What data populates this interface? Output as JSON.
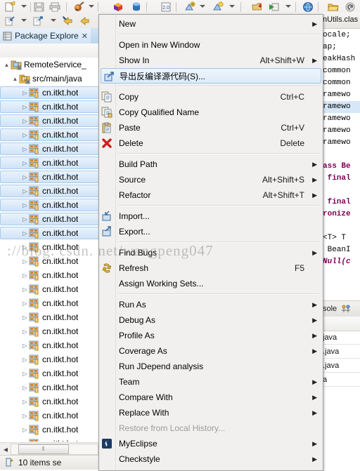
{
  "toolbar": {
    "row1_icons": [
      "new-wizard-icon",
      "dropdown-arrow",
      "save-icon",
      "print-icon",
      "separator",
      "debug-icon",
      "dropdown-arrow",
      "separator",
      "myeclipse-cube-icon",
      "myeclipse-db-icon",
      "separator",
      "java2-icon",
      "separator",
      "new-java-project-icon",
      "dropdown-arrow",
      "new-class-icon",
      "dropdown-arrow",
      "separator",
      "deploy-icon",
      "run-icon",
      "dropdown-arrow",
      "separator",
      "open-browser-icon",
      "separator",
      "open-folder-icon",
      "revert-icon"
    ],
    "row2_icons": [
      "import-icon",
      "dropdown-arrow",
      "export-icon",
      "dropdown-arrow",
      "back-history-icon",
      "forward-history-icon"
    ]
  },
  "package_explorer": {
    "tab_title": "Package Explore",
    "close_glyph": "✕",
    "view_icon": "package-explorer-icon",
    "tree": [
      {
        "level": 0,
        "twisty": "▲",
        "icon": "java-project-icon",
        "label": "RemoteService_",
        "selected": false
      },
      {
        "level": 1,
        "twisty": "▲",
        "icon": "source-folder-icon",
        "label": "src/main/java",
        "selected": false
      },
      {
        "level": 2,
        "twisty": "▷",
        "icon": "package-icon",
        "label": "cn.itkt.hot",
        "selected": true
      },
      {
        "level": 2,
        "twisty": "▷",
        "icon": "package-icon",
        "label": "cn.itkt.hot",
        "selected": true
      },
      {
        "level": 2,
        "twisty": "▷",
        "icon": "package-icon",
        "label": "cn.itkt.hot",
        "selected": true
      },
      {
        "level": 2,
        "twisty": "▷",
        "icon": "package-icon",
        "label": "cn.itkt.hot",
        "selected": true
      },
      {
        "level": 2,
        "twisty": "▷",
        "icon": "package-icon",
        "label": "cn.itkt.hot",
        "selected": true
      },
      {
        "level": 2,
        "twisty": "▷",
        "icon": "package-icon",
        "label": "cn.itkt.hot",
        "selected": true
      },
      {
        "level": 2,
        "twisty": "▷",
        "icon": "package-icon",
        "label": "cn.itkt.hot",
        "selected": true
      },
      {
        "level": 2,
        "twisty": "▷",
        "icon": "package-icon",
        "label": "cn.itkt.hot",
        "selected": true
      },
      {
        "level": 2,
        "twisty": "▷",
        "icon": "package-icon",
        "label": "cn.itkt.hot",
        "selected": true
      },
      {
        "level": 2,
        "twisty": "▷",
        "icon": "package-icon",
        "label": "cn.itkt.hot",
        "selected": true
      },
      {
        "level": 2,
        "twisty": "▷",
        "icon": "package-icon",
        "label": "cn.itkt.hot",
        "selected": true
      },
      {
        "level": 2,
        "twisty": "▷",
        "icon": "package-icon",
        "label": "cn.itkt.hot",
        "selected": false
      },
      {
        "level": 2,
        "twisty": "▷",
        "icon": "package-icon",
        "label": "cn.itkt.hot",
        "selected": false
      },
      {
        "level": 2,
        "twisty": "▷",
        "icon": "package-icon",
        "label": "cn.itkt.hot",
        "selected": false
      },
      {
        "level": 2,
        "twisty": "▷",
        "icon": "package-icon",
        "label": "cn.itkt.hot",
        "selected": false
      },
      {
        "level": 2,
        "twisty": "▷",
        "icon": "package-icon",
        "label": "cn.itkt.hot",
        "selected": false
      },
      {
        "level": 2,
        "twisty": "▷",
        "icon": "package-icon",
        "label": "cn.itkt.hot",
        "selected": false
      },
      {
        "level": 2,
        "twisty": "▷",
        "icon": "package-icon",
        "label": "cn.itkt.hot",
        "selected": false
      },
      {
        "level": 2,
        "twisty": "▷",
        "icon": "package-icon",
        "label": "cn.itkt.hot",
        "selected": false
      },
      {
        "level": 2,
        "twisty": "▷",
        "icon": "package-icon",
        "label": "cn.itkt.hot",
        "selected": false
      },
      {
        "level": 2,
        "twisty": "▷",
        "icon": "package-icon",
        "label": "cn.itkt.hot",
        "selected": false
      },
      {
        "level": 2,
        "twisty": "▷",
        "icon": "package-icon",
        "label": "cn.itkt.hot",
        "selected": false
      },
      {
        "level": 2,
        "twisty": "▷",
        "icon": "package-icon",
        "label": "cn.itkt.hot",
        "selected": false
      },
      {
        "level": 2,
        "twisty": "▷",
        "icon": "package-icon",
        "label": "cn.itkt.hot",
        "selected": false
      },
      {
        "level": 2,
        "twisty": "▷",
        "icon": "package-icon",
        "label": "cn.itkt.hot",
        "selected": false
      },
      {
        "level": 2,
        "twisty": "▷",
        "icon": "package-icon",
        "label": "cn.itkt.hot",
        "selected": false
      },
      {
        "level": 2,
        "twisty": "▷",
        "icon": "package-icon",
        "label": "cn.itkt.hot",
        "selected": false
      }
    ],
    "hscroll": {
      "left_glyph": "◀",
      "thumb_glyph": "⦀"
    }
  },
  "status_bar": {
    "icon": "selection-icon",
    "text": "10 items se"
  },
  "context_menu": {
    "items": [
      {
        "type": "item",
        "label": "New",
        "accel": "",
        "submenu": true,
        "icon": "",
        "enabled": true,
        "highlighted": false
      },
      {
        "type": "separator"
      },
      {
        "type": "item",
        "label": "Open in New Window",
        "accel": "",
        "submenu": false,
        "icon": "",
        "enabled": true,
        "highlighted": false
      },
      {
        "type": "item",
        "label": "Show In",
        "accel": "Alt+Shift+W",
        "submenu": true,
        "icon": "",
        "enabled": true,
        "highlighted": false
      },
      {
        "type": "item",
        "label": "导出反编译源代码(S)...",
        "accel": "",
        "submenu": false,
        "icon": "export-decompiled-icon",
        "enabled": true,
        "highlighted": true
      },
      {
        "type": "separator"
      },
      {
        "type": "item",
        "label": "Copy",
        "accel": "Ctrl+C",
        "submenu": false,
        "icon": "copy-icon",
        "enabled": true,
        "highlighted": false
      },
      {
        "type": "item",
        "label": "Copy Qualified Name",
        "accel": "",
        "submenu": false,
        "icon": "copy-qualified-icon",
        "enabled": true,
        "highlighted": false
      },
      {
        "type": "item",
        "label": "Paste",
        "accel": "Ctrl+V",
        "submenu": false,
        "icon": "paste-icon",
        "enabled": true,
        "highlighted": false
      },
      {
        "type": "item",
        "label": "Delete",
        "accel": "Delete",
        "submenu": false,
        "icon": "delete-icon",
        "enabled": true,
        "highlighted": false
      },
      {
        "type": "separator"
      },
      {
        "type": "item",
        "label": "Build Path",
        "accel": "",
        "submenu": true,
        "icon": "",
        "enabled": true,
        "highlighted": false
      },
      {
        "type": "item",
        "label": "Source",
        "accel": "Alt+Shift+S",
        "submenu": true,
        "icon": "",
        "enabled": true,
        "highlighted": false
      },
      {
        "type": "item",
        "label": "Refactor",
        "accel": "Alt+Shift+T",
        "submenu": true,
        "icon": "",
        "enabled": true,
        "highlighted": false
      },
      {
        "type": "separator"
      },
      {
        "type": "item",
        "label": "Import...",
        "accel": "",
        "submenu": false,
        "icon": "import-icon",
        "enabled": true,
        "highlighted": false
      },
      {
        "type": "item",
        "label": "Export...",
        "accel": "",
        "submenu": false,
        "icon": "export-icon",
        "enabled": true,
        "highlighted": false
      },
      {
        "type": "separator"
      },
      {
        "type": "item",
        "label": "Find Bugs",
        "accel": "",
        "submenu": true,
        "icon": "",
        "enabled": true,
        "highlighted": false
      },
      {
        "type": "item",
        "label": "Refresh",
        "accel": "F5",
        "submenu": false,
        "icon": "refresh-icon",
        "enabled": true,
        "highlighted": false
      },
      {
        "type": "item",
        "label": "Assign Working Sets...",
        "accel": "",
        "submenu": false,
        "icon": "",
        "enabled": true,
        "highlighted": false
      },
      {
        "type": "separator"
      },
      {
        "type": "item",
        "label": "Run As",
        "accel": "",
        "submenu": true,
        "icon": "",
        "enabled": true,
        "highlighted": false
      },
      {
        "type": "item",
        "label": "Debug As",
        "accel": "",
        "submenu": true,
        "icon": "",
        "enabled": true,
        "highlighted": false
      },
      {
        "type": "item",
        "label": "Profile As",
        "accel": "",
        "submenu": true,
        "icon": "",
        "enabled": true,
        "highlighted": false
      },
      {
        "type": "item",
        "label": "Coverage As",
        "accel": "",
        "submenu": true,
        "icon": "",
        "enabled": true,
        "highlighted": false
      },
      {
        "type": "item",
        "label": "Run JDepend analysis",
        "accel": "",
        "submenu": false,
        "icon": "",
        "enabled": true,
        "highlighted": false
      },
      {
        "type": "item",
        "label": "Team",
        "accel": "",
        "submenu": true,
        "icon": "",
        "enabled": true,
        "highlighted": false
      },
      {
        "type": "item",
        "label": "Compare With",
        "accel": "",
        "submenu": true,
        "icon": "",
        "enabled": true,
        "highlighted": false
      },
      {
        "type": "item",
        "label": "Replace With",
        "accel": "",
        "submenu": true,
        "icon": "",
        "enabled": true,
        "highlighted": false
      },
      {
        "type": "item",
        "label": "Restore from Local History...",
        "accel": "",
        "submenu": false,
        "icon": "",
        "enabled": false,
        "highlighted": false
      },
      {
        "type": "item",
        "label": "MyEclipse",
        "accel": "",
        "submenu": true,
        "icon": "myeclipse-icon",
        "enabled": true,
        "highlighted": false
      },
      {
        "type": "item",
        "label": "Checkstyle",
        "accel": "",
        "submenu": true,
        "icon": "",
        "enabled": true,
        "highlighted": false
      }
    ]
  },
  "editor": {
    "tab_label_fragment": "nUtils.clas",
    "code_lines": [
      {
        "text": "ocale;",
        "highlighted": false,
        "style": "pl"
      },
      {
        "text": "ap;",
        "highlighted": false,
        "style": "pl"
      },
      {
        "text": "eakHash",
        "highlighted": false,
        "style": "pl"
      },
      {
        "text": "common",
        "highlighted": false,
        "style": "pl"
      },
      {
        "text": "common",
        "highlighted": false,
        "style": "pl"
      },
      {
        "text": "ramewo",
        "highlighted": false,
        "style": "pl"
      },
      {
        "text": "ramewo",
        "highlighted": true,
        "style": "pl"
      },
      {
        "text": "ramewo",
        "highlighted": false,
        "style": "pl"
      },
      {
        "text": "ramewo",
        "highlighted": false,
        "style": "pl"
      },
      {
        "text": "ramewo",
        "highlighted": false,
        "style": "pl"
      },
      {
        "text": "",
        "highlighted": false,
        "style": "pl"
      },
      {
        "text": "ass Be",
        "highlighted": false,
        "style": "kw"
      },
      {
        "text": " final",
        "highlighted": false,
        "style": "kw"
      },
      {
        "text": "",
        "highlighted": false,
        "style": "pl"
      },
      {
        "text": " final",
        "highlighted": false,
        "style": "kw"
      },
      {
        "text": "ronize",
        "highlighted": false,
        "style": "kw"
      },
      {
        "text": "",
        "highlighted": false,
        "style": "pl"
      },
      {
        "text": "<T> T",
        "highlighted": false,
        "style": "pl"
      },
      {
        "text": " BeanI",
        "highlighted": false,
        "style": "pl"
      },
      {
        "text": "Null(c",
        "highlighted": false,
        "style": "kw2"
      }
    ],
    "bottom_pane": {
      "tab_label_fragment": "sole",
      "tab_icon": "filter-icon",
      "rows": [
        "java",
        ".java",
        ".java",
        "a"
      ]
    }
  },
  "watermark": {
    "text": "://blog. csdn. net/wangpeng047"
  },
  "colors": {
    "menu_bg": "#f1f0ee",
    "menu_border": "#a0a0a0",
    "highlight_bg": "#dcebf9",
    "highlight_border": "#9fc6e8",
    "tree_selection": "#cfe3f7",
    "tab_active": "#bcd6ef",
    "disabled_text": "#9b9b9b",
    "keyword": "#7f0055"
  }
}
